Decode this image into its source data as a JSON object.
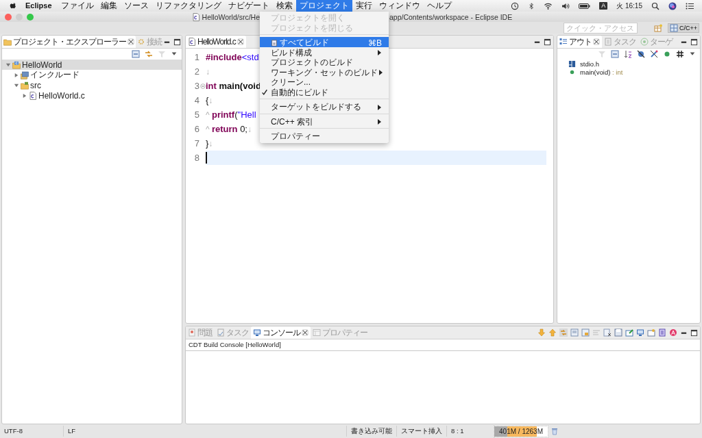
{
  "menubar": {
    "app": "Eclipse",
    "menus": [
      {
        "label": "ファイル",
        "selected": false
      },
      {
        "label": "編集",
        "selected": false
      },
      {
        "label": "ソース",
        "selected": false
      },
      {
        "label": "リファクタリング",
        "selected": false
      },
      {
        "label": "ナビゲート",
        "selected": false
      },
      {
        "label": "検索",
        "selected": false
      },
      {
        "label": "プロジェクト",
        "selected": true
      },
      {
        "label": "実行",
        "selected": false
      },
      {
        "label": "ウィンドウ",
        "selected": false
      },
      {
        "label": "ヘルプ",
        "selected": false
      }
    ],
    "input_indicator": "A",
    "clock": "火 16:15"
  },
  "window": {
    "title_start": "HelloWorld/src/He",
    "title_end": "app/Contents/workspace - Eclipse IDE"
  },
  "toolbar": {
    "quick_access": {
      "placeholder": "クイック・アクセス"
    },
    "perspective": "C/C++"
  },
  "project_menu": {
    "items": [
      {
        "kind": "item",
        "label": "プロジェクトを開く",
        "disabled": true,
        "selected": false,
        "checked": false,
        "submenu": false
      },
      {
        "kind": "item",
        "label": "プロジェクトを閉じる",
        "disabled": true,
        "selected": false,
        "checked": false,
        "submenu": false
      },
      {
        "kind": "separator"
      },
      {
        "kind": "item-with-icon",
        "label": "すべてビルド",
        "shortcut": "⌘B",
        "disabled": false,
        "selected": true,
        "checked": false,
        "submenu": false
      },
      {
        "kind": "item",
        "label": "ビルド構成",
        "disabled": false,
        "selected": false,
        "checked": false,
        "submenu": true
      },
      {
        "kind": "item",
        "label": "プロジェクトのビルド",
        "disabled": false,
        "selected": false,
        "checked": false,
        "submenu": false
      },
      {
        "kind": "item",
        "label": "ワーキング・セットのビルド",
        "disabled": false,
        "selected": false,
        "checked": false,
        "submenu": true
      },
      {
        "kind": "item",
        "label": "クリーン...",
        "disabled": false,
        "selected": false,
        "checked": false,
        "submenu": false
      },
      {
        "kind": "item",
        "label": "自動的にビルド",
        "disabled": false,
        "selected": false,
        "checked": true,
        "submenu": false
      },
      {
        "kind": "separator"
      },
      {
        "kind": "item",
        "label": "ターゲットをビルドする",
        "disabled": false,
        "selected": false,
        "checked": false,
        "submenu": true
      },
      {
        "kind": "separator"
      },
      {
        "kind": "item",
        "label": "C/C++ 索引",
        "disabled": false,
        "selected": false,
        "checked": false,
        "submenu": true
      },
      {
        "kind": "separator"
      },
      {
        "kind": "item",
        "label": "プロパティー",
        "disabled": false,
        "selected": false,
        "checked": false,
        "submenu": false
      }
    ]
  },
  "project_explorer": {
    "tabs": [
      {
        "label": "プロジェクト・エクスプローラー",
        "selected": true
      },
      {
        "label": "接続",
        "selected": false
      }
    ],
    "tree": [
      {
        "label": "HelloWorld",
        "kind": "project",
        "expanded": true,
        "selected": true,
        "children": [
          {
            "label": "インクルード",
            "kind": "includes",
            "expanded": false,
            "selected": false
          },
          {
            "label": "src",
            "kind": "folder",
            "expanded": true,
            "selected": false,
            "children": [
              {
                "label": "HelloWorld.c",
                "kind": "file",
                "expanded": false,
                "selected": false
              }
            ]
          }
        ]
      }
    ]
  },
  "editor": {
    "tabs": [
      {
        "label": "HelloWorld.c",
        "selected": true
      }
    ],
    "lines": [
      {
        "number": "1",
        "current": false,
        "foldable": false,
        "tokens": [
          {
            "text": "#include",
            "kind": "keyword"
          },
          {
            "text": "<std",
            "kind": "string"
          }
        ]
      },
      {
        "number": "2",
        "current": false,
        "foldable": false,
        "tokens": [
          {
            "text": "↓",
            "kind": "whitespace"
          }
        ]
      },
      {
        "number": "3",
        "current": false,
        "foldable": true,
        "tokens": [
          {
            "text": "int",
            "kind": "keyword"
          },
          {
            "text": " main(void",
            "kind": "name"
          }
        ]
      },
      {
        "number": "4",
        "current": false,
        "foldable": false,
        "tokens": [
          {
            "text": "{",
            "kind": "plain"
          },
          {
            "text": "↓",
            "kind": "whitespace"
          }
        ]
      },
      {
        "number": "5",
        "current": false,
        "foldable": false,
        "tokens": [
          {
            "text": "^ ",
            "kind": "whitespace"
          },
          {
            "text": "printf",
            "kind": "keyword"
          },
          {
            "text": "(",
            "kind": "plain"
          },
          {
            "text": "\"Hell",
            "kind": "string"
          }
        ]
      },
      {
        "number": "6",
        "current": false,
        "foldable": false,
        "tokens": [
          {
            "text": "^ ",
            "kind": "whitespace"
          },
          {
            "text": "return",
            "kind": "keyword"
          },
          {
            "text": " 0;",
            "kind": "plain"
          },
          {
            "text": "↓",
            "kind": "whitespace"
          }
        ]
      },
      {
        "number": "7",
        "current": false,
        "foldable": false,
        "tokens": [
          {
            "text": "}",
            "kind": "plain"
          },
          {
            "text": "↓",
            "kind": "whitespace"
          }
        ]
      },
      {
        "number": "8",
        "current": true,
        "foldable": false
      }
    ]
  },
  "outline": {
    "tabs": [
      {
        "label": "アウト",
        "selected": true
      },
      {
        "label": "タスク",
        "selected": false
      },
      {
        "label": "ターゲ",
        "selected": false
      }
    ],
    "items": [
      {
        "kind": "include",
        "label": "stdio.h"
      },
      {
        "kind": "function",
        "label": "main(void)",
        "type": ": int"
      }
    ]
  },
  "console": {
    "tabs": [
      {
        "label": "問題",
        "selected": false
      },
      {
        "label": "タスク",
        "selected": false
      },
      {
        "label": "コンソール",
        "selected": true
      },
      {
        "label": "プロパティー",
        "selected": false
      }
    ],
    "title": "CDT Build Console [HelloWorld]"
  },
  "status_bar": {
    "encoding": "UTF-8",
    "line_delimiter": "LF",
    "write_mode": "書き込み可能",
    "insert_mode": "スマート挿入",
    "position": "8 : 1",
    "heap": {
      "reading": "401M / 1263M",
      "level": 0.8
    }
  }
}
